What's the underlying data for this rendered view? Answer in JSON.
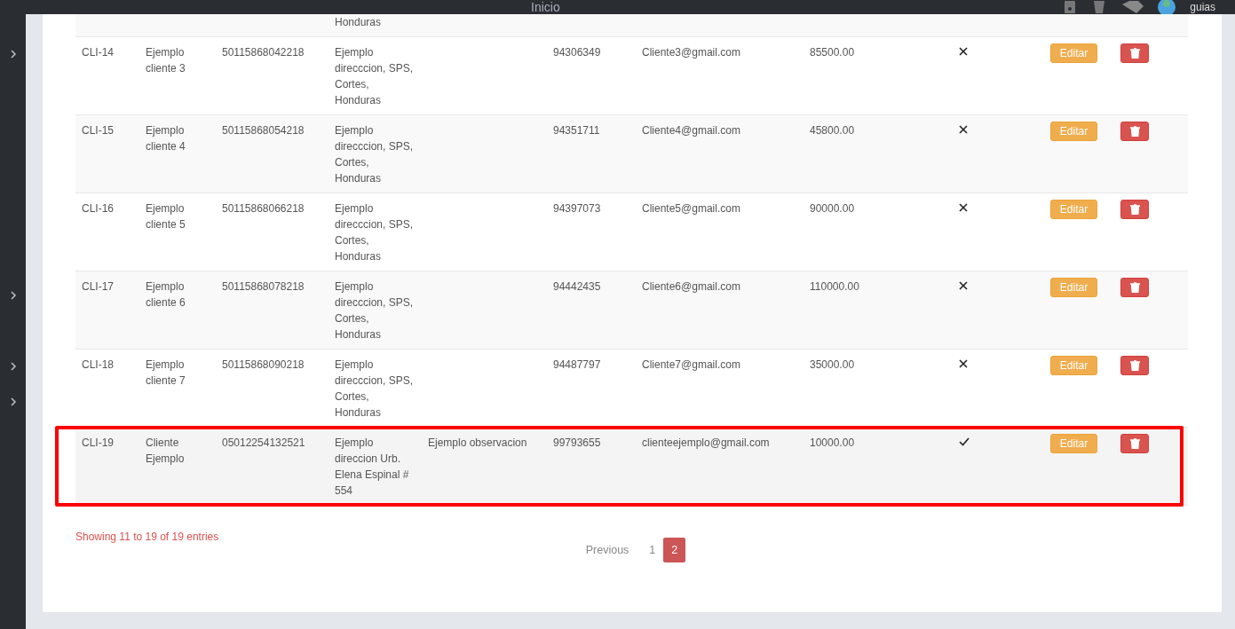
{
  "top_bar": {
    "title": "Inicio",
    "user": "guias"
  },
  "table": {
    "rows": [
      {
        "id": "",
        "name": "",
        "identity": "",
        "address": "Honduras",
        "observation": "",
        "phone": "",
        "email": "",
        "amount": "",
        "active": null
      },
      {
        "id": "CLI-14",
        "name": "Ejemplo cliente 3",
        "identity": "50115868042218",
        "address": "Ejemplo direcccion, SPS, Cortes, Honduras",
        "observation": "",
        "phone": "94306349",
        "email": "Cliente3@gmail.com",
        "amount": "85500.00",
        "active": false,
        "annotated": false,
        "edit_label": "Editar"
      },
      {
        "id": "CLI-15",
        "name": "Ejemplo cliente 4",
        "identity": "50115868054218",
        "address": "Ejemplo direcccion, SPS, Cortes, Honduras",
        "observation": "",
        "phone": "94351711",
        "email": "Cliente4@gmail.com",
        "amount": "45800.00",
        "active": false,
        "annotated": false,
        "edit_label": "Editar"
      },
      {
        "id": "CLI-16",
        "name": "Ejemplo cliente 5",
        "identity": "50115868066218",
        "address": "Ejemplo direcccion, SPS, Cortes, Honduras",
        "observation": "",
        "phone": "94397073",
        "email": "Cliente5@gmail.com",
        "amount": "90000.00",
        "active": false,
        "annotated": false,
        "edit_label": "Editar"
      },
      {
        "id": "CLI-17",
        "name": "Ejemplo cliente 6",
        "identity": "50115868078218",
        "address": "Ejemplo direcccion, SPS, Cortes, Honduras",
        "observation": "",
        "phone": "94442435",
        "email": "Cliente6@gmail.com",
        "amount": "110000.00",
        "active": false,
        "annotated": false,
        "edit_label": "Editar"
      },
      {
        "id": "CLI-18",
        "name": "Ejemplo cliente 7",
        "identity": "50115868090218",
        "address": "Ejemplo direcccion, SPS, Cortes, Honduras",
        "observation": "",
        "phone": "94487797",
        "email": "Cliente7@gmail.com",
        "amount": "35000.00",
        "active": false,
        "annotated": false,
        "edit_label": "Editar"
      },
      {
        "id": "CLI-19",
        "name": "Cliente Ejemplo",
        "identity": "05012254132521",
        "address": "Ejemplo direccion Urb. Elena Espinal # 554",
        "observation": "Ejemplo observacion",
        "phone": "99793655",
        "email": "clienteejemplo@gmail.com",
        "amount": "10000.00",
        "active": true,
        "annotated": true,
        "edit_label": "Editar"
      }
    ]
  },
  "footer": {
    "info": "Showing 11 to 19 of 19 entries",
    "pagination": [
      {
        "label": "Previous",
        "kind": "prev",
        "selected": false
      },
      {
        "label": "1",
        "kind": "page",
        "selected": false
      },
      {
        "label": "2",
        "kind": "page",
        "selected": true
      }
    ]
  }
}
